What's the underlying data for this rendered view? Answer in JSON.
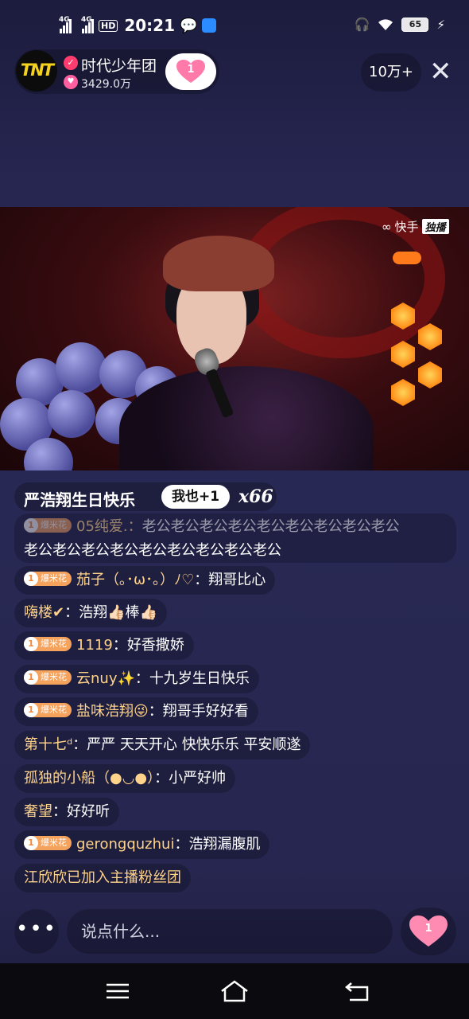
{
  "status_bar": {
    "net1": "4G",
    "net2": "4G",
    "hd": "HD",
    "time": "20:21",
    "battery": "65"
  },
  "host": {
    "avatar_text": "TNT",
    "name": "时代少年团",
    "likes": "3429.0万",
    "follow_count": "1"
  },
  "viewers": "10万+",
  "close_icon": "close-icon",
  "video": {
    "watermark_brand": "快手",
    "watermark_tag": "独播"
  },
  "promo": {
    "text": "严浩翔生日快乐",
    "button": "我也+1",
    "count": "x66"
  },
  "badge_label": "爆米花",
  "badge_level": "1",
  "first_comment": {
    "user": "05纯爱.",
    "text_line1": "老公老公老公老公老公老公老公老公老公",
    "text_line2": "老公老公老公老公老公老公老公老公老公"
  },
  "comments": [
    {
      "badge": true,
      "user": "茄子（｡･ω･｡）ﾉ♡",
      "text": "翔哥比心"
    },
    {
      "badge": false,
      "user": "嗨楼✔",
      "text": "浩翔👍🏻棒👍🏻"
    },
    {
      "badge": true,
      "user": "1119",
      "text": "好香撒娇"
    },
    {
      "badge": true,
      "user": "云nuy✨",
      "text": "十九岁生日快乐"
    },
    {
      "badge": true,
      "user": "盐味浩翔😜",
      "text": "翔哥手好好看"
    },
    {
      "badge": false,
      "user": "第十七ᵈ",
      "text": "严严 天天开心 快快乐乐 平安顺遂"
    },
    {
      "badge": false,
      "user": "孤独的小船（●◡●）",
      "text": "小严好帅"
    },
    {
      "badge": false,
      "user": "奢望",
      "text": "好好听"
    },
    {
      "badge": true,
      "user": "gerongquzhui",
      "text": "浩翔漏腹肌"
    },
    {
      "badge": false,
      "user": "江欣欣已加入主播粉丝团",
      "text": ""
    }
  ],
  "input": {
    "more": "•••",
    "placeholder": "说点什么...",
    "like_count": "1"
  },
  "colors": {
    "username": "#ffd38a",
    "badge": "#f4a25c",
    "heart": "#ff7aa8",
    "background": "#262651"
  }
}
